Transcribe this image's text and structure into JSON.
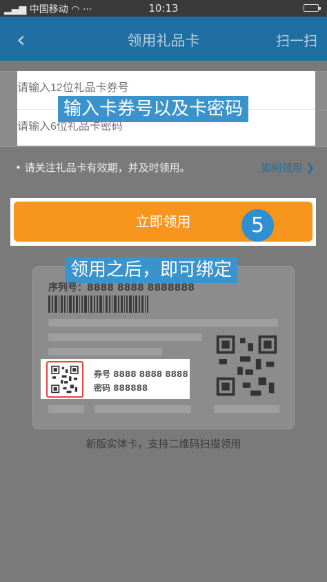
{
  "status_bar": {
    "left": "中国移动",
    "time": "10:13"
  },
  "nav": {
    "back_icon": "chevron-left-icon",
    "title": "领用礼品卡",
    "scan_label": "扫一扫"
  },
  "form": {
    "card_number_placeholder": "请输入12位礼品卡券号",
    "card_password_placeholder": "请输入6位礼品卡密码"
  },
  "notice": {
    "text": "• 请关注礼品卡有效期，并及时领用。",
    "how_label": "如何领用 ❯"
  },
  "claim_button_label": "立即领用",
  "tutorial": {
    "tip_input": "输入卡券号以及卡密码",
    "step_number": "5",
    "tip_after": "领用之后，即可绑定"
  },
  "sample_card": {
    "serial": "序列号：8888 8888 8888888",
    "voucher_line": "券号 8888 8888 8888",
    "password_line": "密码 888888",
    "caption": "新版实体卡，支持二维码扫描领用"
  },
  "colors": {
    "nav_bg": "#1f6fa3",
    "button": "#f7951d",
    "tip_bg": "#3b93cc",
    "highlight_border": "#e64444"
  }
}
